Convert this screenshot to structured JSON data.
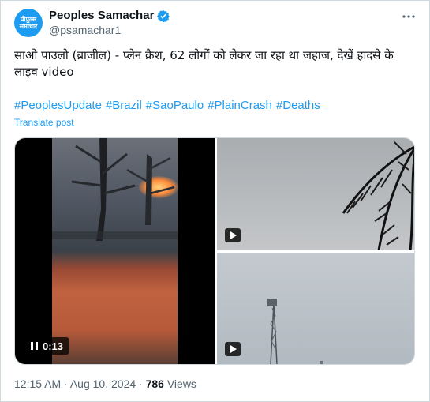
{
  "author": {
    "display_name": "Peoples Samachar",
    "handle": "@psamachar1",
    "avatar_line1": "पीपुल्स",
    "avatar_line2": "समाचार"
  },
  "post": {
    "text": "साओ पाउलो (ब्राजील) - प्लेन क्रैश,  62 लोगों को लेकर जा रहा था जहाज, देखें हादसे के लाइव video",
    "hashtags": [
      "#PeoplesUpdate",
      "#Brazil",
      "#SaoPaulo",
      "#PlainCrash",
      "#Deaths"
    ],
    "translate_label": "Translate post"
  },
  "media": {
    "video_time": "0:13"
  },
  "meta": {
    "time": "12:15 AM",
    "separator": "·",
    "date": "Aug 10, 2024",
    "views_count": "786",
    "views_label": "Views"
  },
  "icons": {
    "verified": "verified-badge-icon",
    "more": "more-icon",
    "pause": "pause-icon",
    "play": "play-icon"
  },
  "colors": {
    "accent": "#1d9bf0",
    "text": "#0f1419",
    "secondary": "#536471",
    "border": "#cfd9de"
  }
}
